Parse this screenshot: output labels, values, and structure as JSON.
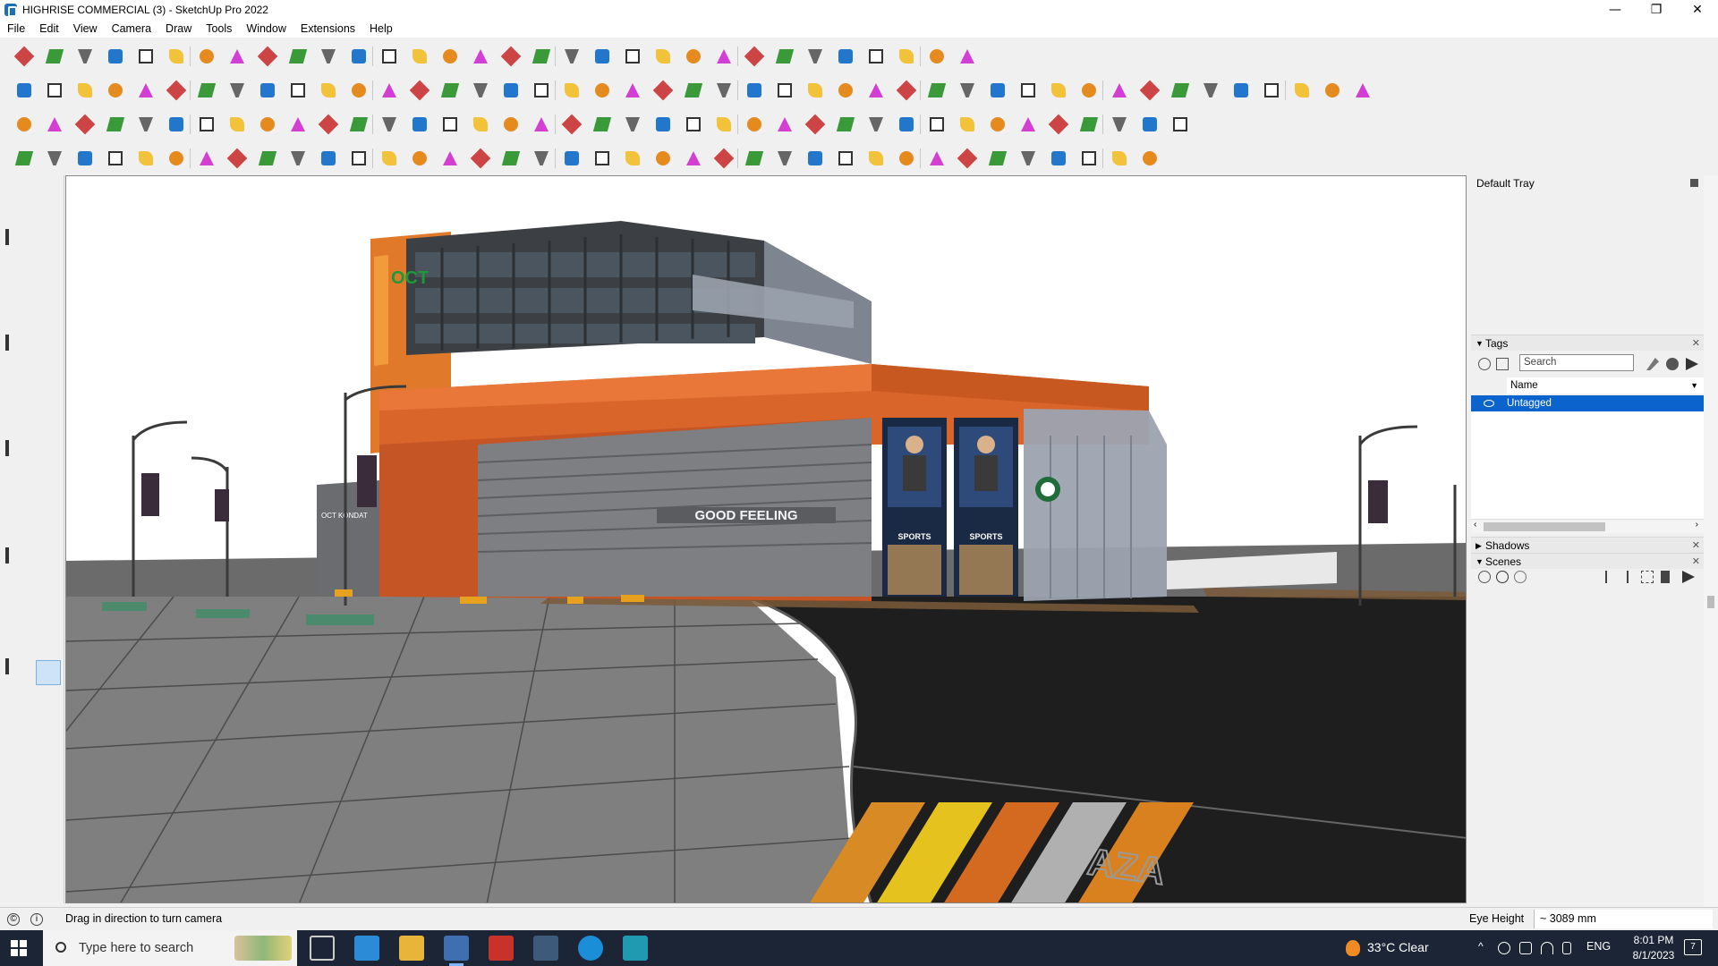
{
  "window": {
    "title": "HIGHRISE COMMERCIAL (3) - SketchUp Pro 2022",
    "minimize": "—",
    "restore": "❐",
    "close": "✕"
  },
  "menu": [
    "File",
    "Edit",
    "View",
    "Camera",
    "Draw",
    "Tools",
    "Window",
    "Extensions",
    "Help"
  ],
  "scene": {
    "sign_oct": "OCT",
    "sign_shop": "OCT KONDAT",
    "sign_main": "GOOD FEELING",
    "sign_sports_1": "SPORTS",
    "sign_sports_2": "SPORTS",
    "road_marking": "AZA"
  },
  "tray": {
    "title": "Default Tray",
    "tags": {
      "title": "Tags",
      "search_placeholder": "Search",
      "column_name": "Name",
      "rows": [
        "Untagged"
      ]
    },
    "shadows": {
      "title": "Shadows"
    },
    "scenes": {
      "title": "Scenes"
    }
  },
  "status": {
    "message": "Drag in direction to turn camera",
    "measure_label": "Eye Height",
    "measure_value": "~ 3089 mm"
  },
  "taskbar": {
    "search_placeholder": "Type here to search",
    "weather": "33°C  Clear",
    "language": "ENG",
    "time": "8:01 PM",
    "date": "8/1/2023",
    "notifications": "7"
  }
}
